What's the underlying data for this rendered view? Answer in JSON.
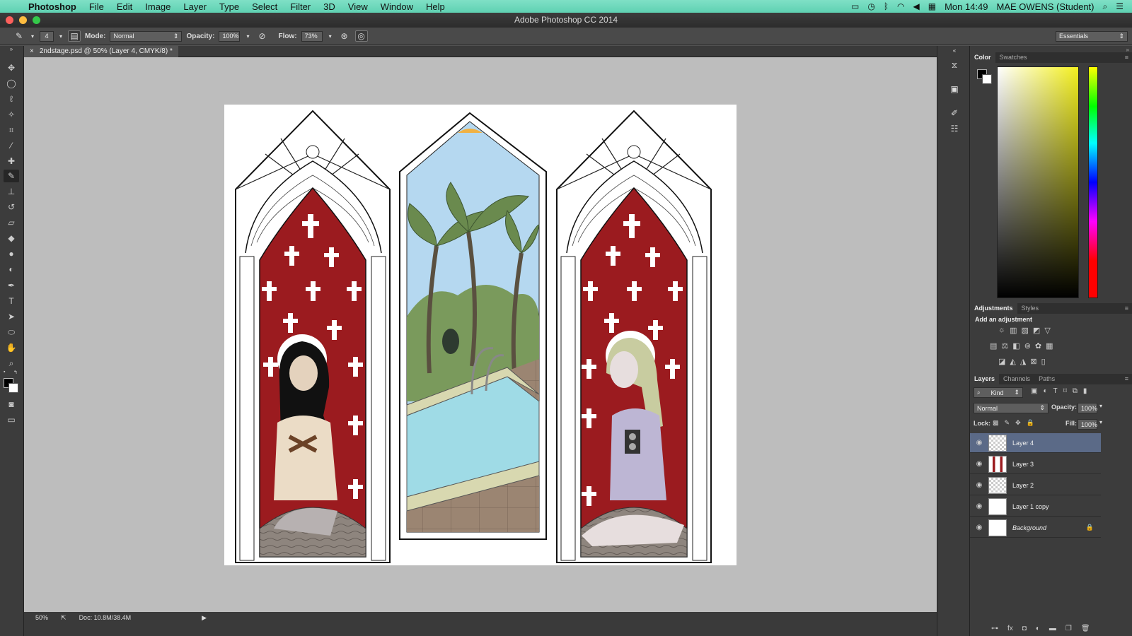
{
  "menubar": {
    "app": "Photoshop",
    "menus": [
      "File",
      "Edit",
      "Image",
      "Layer",
      "Type",
      "Select",
      "Filter",
      "3D",
      "View",
      "Window",
      "Help"
    ],
    "clock": "Mon 14:49",
    "user": "MAE OWENS (Student)"
  },
  "window": {
    "title": "Adobe Photoshop CC 2014"
  },
  "options": {
    "brush_size": "4",
    "mode_label": "Mode:",
    "mode_value": "Normal",
    "opacity_label": "Opacity:",
    "opacity_value": "100%",
    "flow_label": "Flow:",
    "flow_value": "73%",
    "workspace": "Essentials"
  },
  "document": {
    "tab_title": "2ndstage.psd @ 50% (Layer 4, CMYK/8) *",
    "close": "×"
  },
  "status": {
    "zoom": "50%",
    "doc_size": "Doc: 10.8M/38.4M"
  },
  "color_panel": {
    "tabs": [
      "Color",
      "Swatches"
    ]
  },
  "adjustments_panel": {
    "tabs": [
      "Adjustments",
      "Styles"
    ],
    "heading": "Add an adjustment"
  },
  "layers_panel": {
    "tabs": [
      "Layers",
      "Channels",
      "Paths"
    ],
    "filter": "Kind",
    "blend_mode": "Normal",
    "opacity_label": "Opacity:",
    "opacity_value": "100%",
    "lock_label": "Lock:",
    "fill_label": "Fill:",
    "fill_value": "100%",
    "layers": [
      {
        "name": "Layer 4",
        "selected": true
      },
      {
        "name": "Layer 3"
      },
      {
        "name": "Layer 2"
      },
      {
        "name": "Layer 1 copy"
      },
      {
        "name": "Background",
        "locked": true
      }
    ]
  },
  "colors": {
    "artwork_red": "#9b1b1f",
    "sky": "#b5d8f0",
    "pool": "#9fdbe6",
    "selection": "#5b6a87"
  }
}
